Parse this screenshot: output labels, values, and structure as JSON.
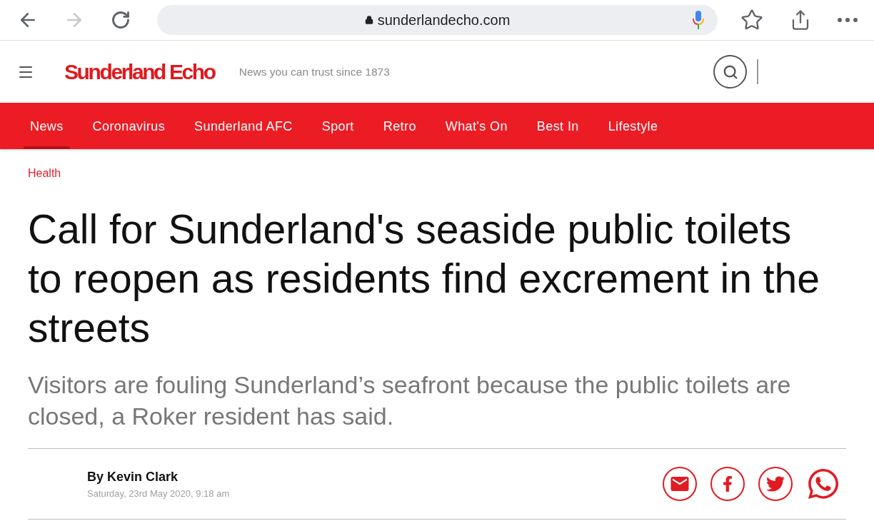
{
  "browser": {
    "back": {
      "disabled": false
    },
    "forward": {
      "disabled": true
    },
    "url": "sunderlandecho.com"
  },
  "header": {
    "logo": "Sunderland Echo",
    "tagline": "News you can trust since 1873"
  },
  "nav": [
    {
      "label": "News",
      "selected": true
    },
    {
      "label": "Coronavirus",
      "selected": false
    },
    {
      "label": "Sunderland AFC",
      "selected": false
    },
    {
      "label": "Sport",
      "selected": false
    },
    {
      "label": "Retro",
      "selected": false
    },
    {
      "label": "What's On",
      "selected": false
    },
    {
      "label": "Best In",
      "selected": false
    },
    {
      "label": "Lifestyle",
      "selected": false
    }
  ],
  "article": {
    "category": "Health",
    "headline": "Call for Sunderland's seaside public toilets to reopen as residents find excrement in the streets",
    "standfirst": "Visitors are fouling Sunderland’s seafront because the public toilets are closed, a Roker resident has said.",
    "author": "By Kevin Clark",
    "date": "Saturday, 23rd May 2020, 9:18 am",
    "share": [
      {
        "kind": "email"
      },
      {
        "kind": "facebook"
      },
      {
        "kind": "twitter"
      },
      {
        "kind": "whatsapp"
      }
    ]
  }
}
